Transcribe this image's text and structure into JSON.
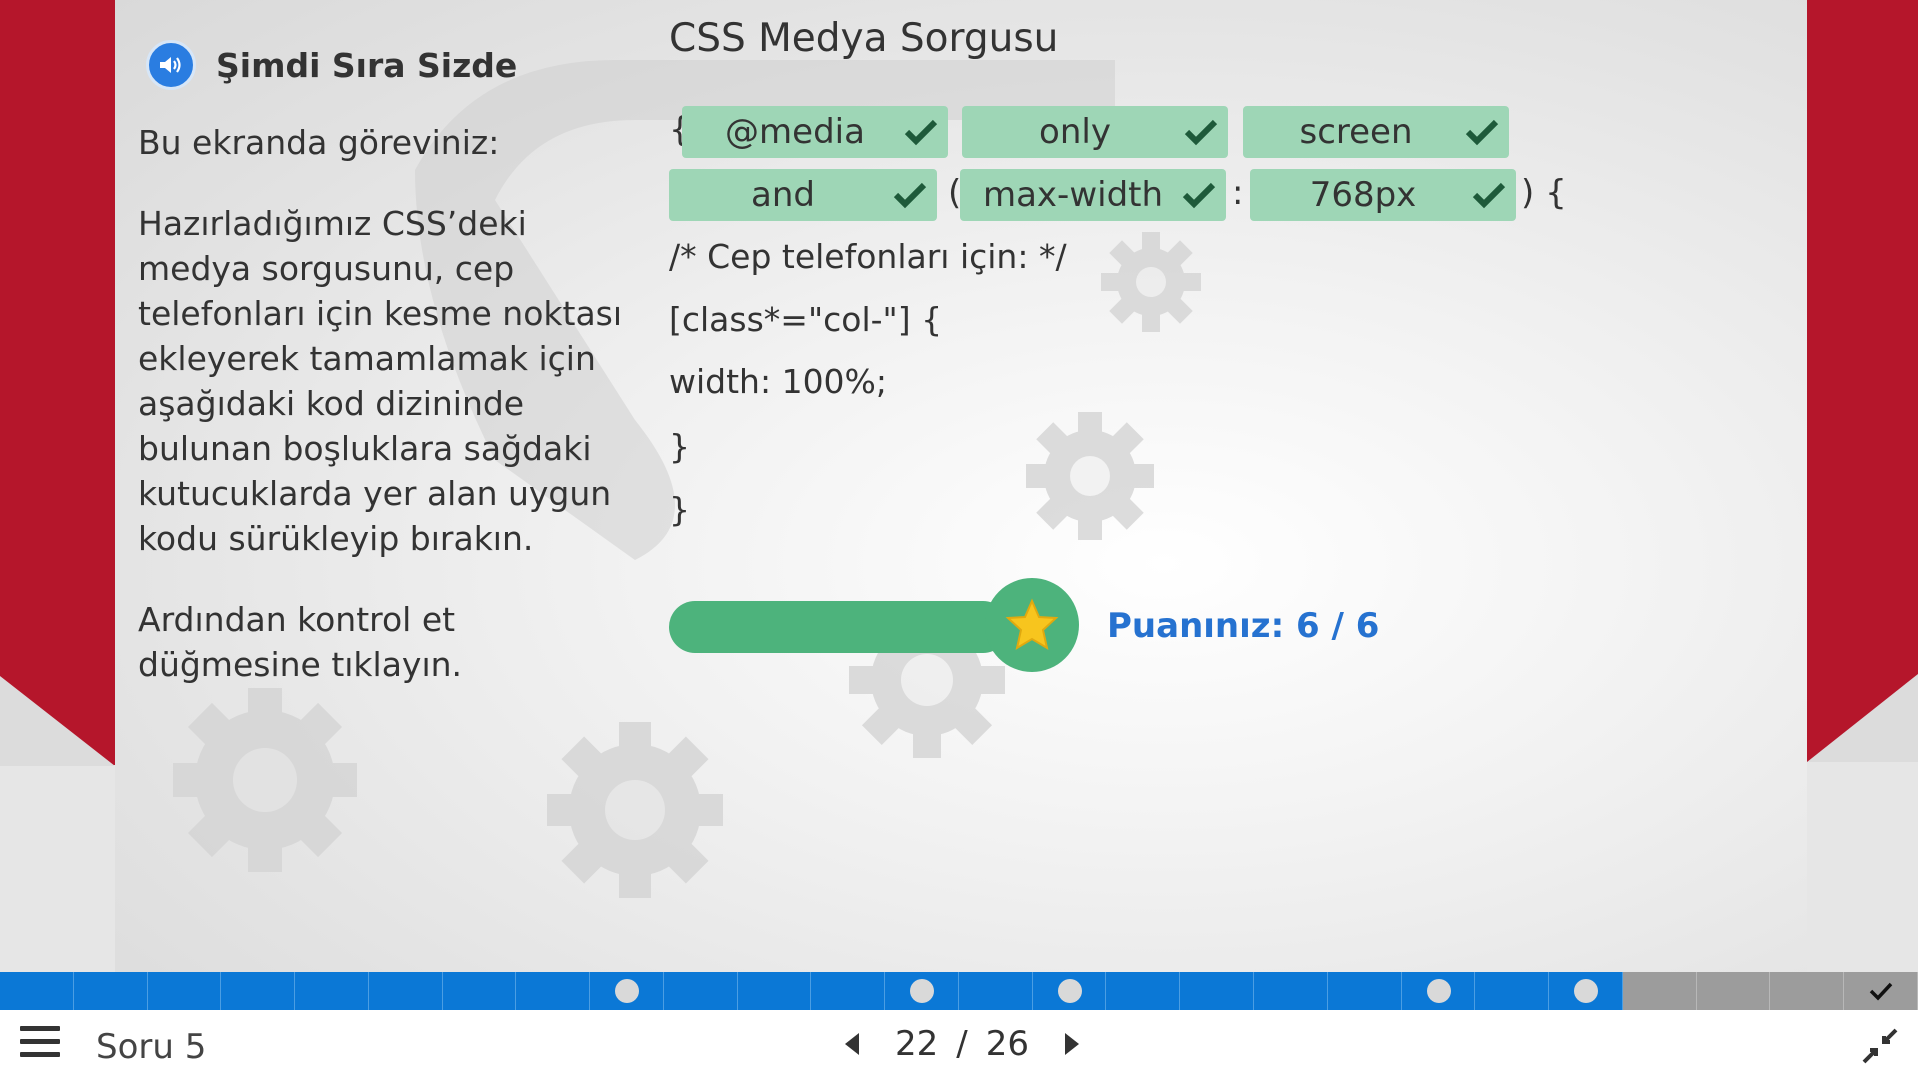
{
  "left": {
    "title": "Şimdi Sıra Sizde",
    "intro": "Bu ekranda göreviniz:",
    "task": "Hazırladığımız CSS’deki medya sorgusunu, cep telefonları için kesme noktası ekleyerek tamamlamak için aşağıdaki kod dizininde bulunan boşluklara sağdaki kutucuklarda yer alan uygun kodu sürükleyip bırakın.",
    "instruction": "Ardından kontrol et düğmesine tıklayın."
  },
  "code": {
    "title": "CSS Medya Sorgusu",
    "open_brace": "{",
    "open_paren": "(",
    "colon": ":",
    "close_paren_brace": ") {",
    "chips": [
      "@media",
      "only",
      "screen",
      "and",
      "max-width",
      "768px"
    ],
    "lines": [
      "/* Cep telefonları için: */",
      "[class*=\"col-\"] {",
      "width: 100%;",
      "}",
      "}"
    ]
  },
  "score": {
    "label": "Puanınız: 6 / 6",
    "progress": 1.0
  },
  "nav": {
    "segments": 26,
    "current": 22,
    "dots": [
      9,
      13,
      15,
      20,
      22
    ]
  },
  "footer": {
    "section": "Soru 5",
    "current": "22",
    "separator": "/",
    "total": "26"
  },
  "colors": {
    "ribbon": "#b5162b",
    "chip": "#9ed6b6",
    "progress": "#4db37c",
    "score": "#2672d0",
    "navbar": "#0b78d6"
  }
}
